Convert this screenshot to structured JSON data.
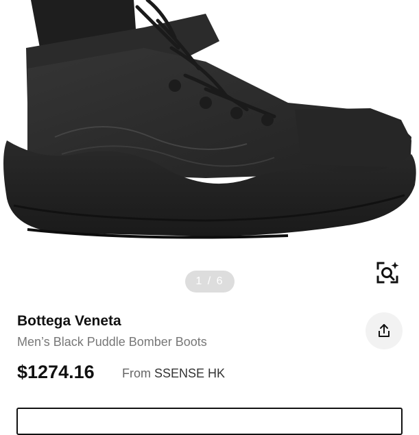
{
  "product": {
    "brand": "Bottega Veneta",
    "name": "Men’s Black Puddle Bomber Boots",
    "price": "$1274.16",
    "source_prefix": "From",
    "source_store": "SSENSE HK"
  },
  "gallery": {
    "pager_text": "1 / 6",
    "current": 1,
    "total": 6
  },
  "icons": {
    "zoom": "zoom-sparkle-icon",
    "share": "share-icon"
  },
  "colors": {
    "boot": "#2c2c2c",
    "pager_bg": "#dddddd",
    "share_bg": "#f2f2f2",
    "text_muted": "#777777"
  }
}
